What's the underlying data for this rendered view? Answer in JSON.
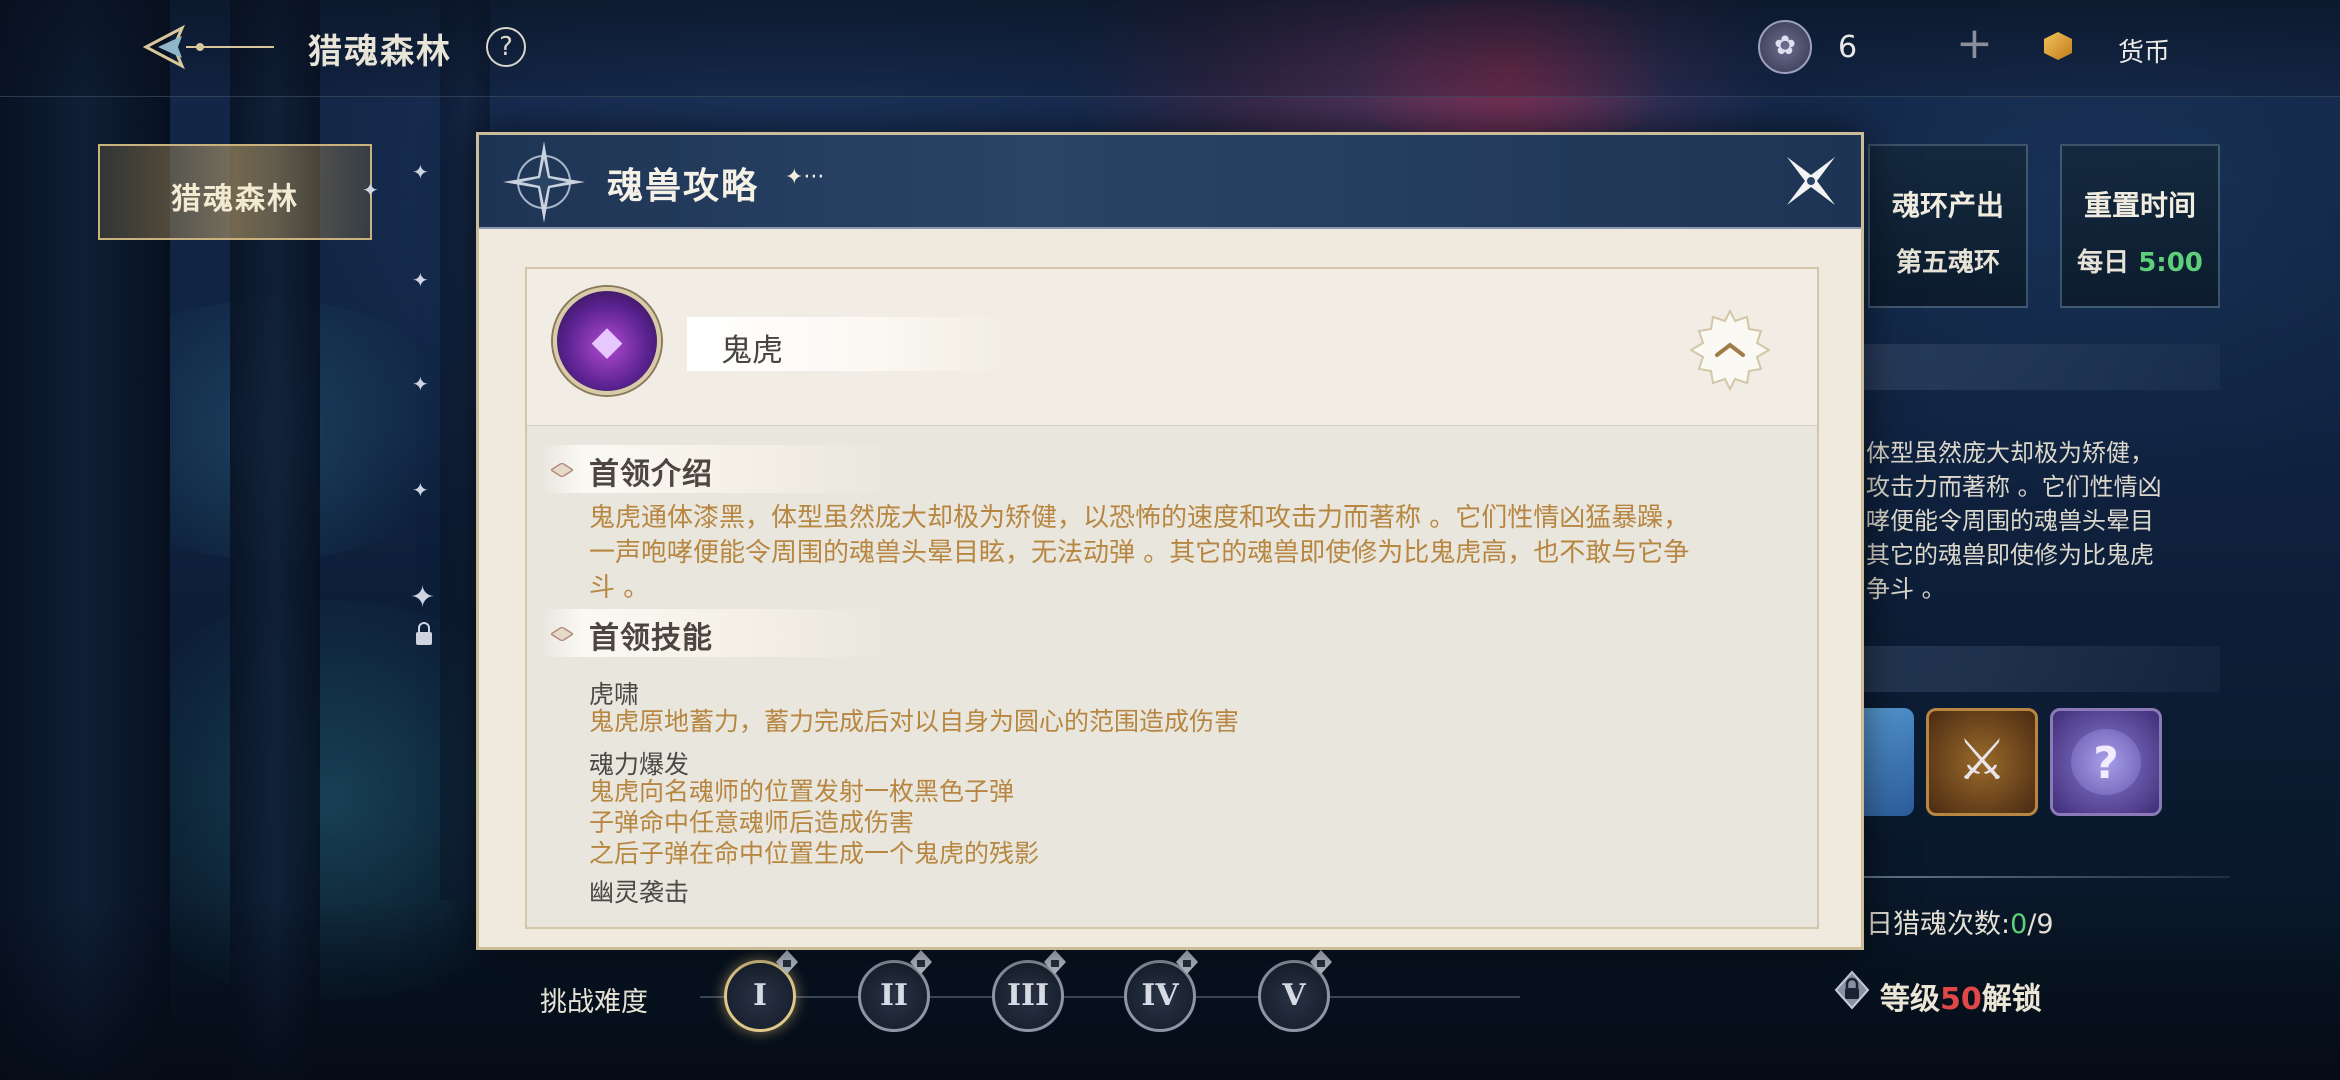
{
  "topbar": {
    "title": "猎魂森林",
    "help_glyph": "?",
    "emblem_count": "6",
    "plus_glyph": "+",
    "currency_label": "货币"
  },
  "sidebar": {
    "active_tab": "猎魂森林"
  },
  "right_panel": {
    "ring_title": "魂环产出",
    "ring_value": "第五魂环",
    "reset_title": "重置时间",
    "reset_prefix": "每日",
    "reset_time": "5:00",
    "desc_lines": [
      "体型虽然庞大却极为矫健，",
      "攻击力而著称 。它们性情凶",
      "哮便能令周围的魂兽头晕目",
      "其它的魂兽即使修为比鬼虎",
      "争斗 。"
    ],
    "hunt_prefix": "日猎魂次数:",
    "hunt_current": "0",
    "hunt_total": "/9",
    "unlock_prefix": "等级",
    "unlock_level": "50",
    "unlock_suffix": "解锁"
  },
  "difficulty": {
    "label": "挑战难度",
    "levels": [
      "I",
      "II",
      "III",
      "IV",
      "V"
    ],
    "selected": "I"
  },
  "modal": {
    "title": "魂兽攻略",
    "title_deco": "✦···",
    "boss_name": "鬼虎",
    "intro_title": "首领介绍",
    "intro_lines": [
      "鬼虎通体漆黑，体型虽然庞大却极为矫健，以恐怖的速度和攻击力而著称 。它们性情凶猛暴躁，",
      "一声咆哮便能令周围的魂兽头晕目眩，无法动弹 。其它的魂兽即使修为比鬼虎高，也不敢与它争",
      "斗 。"
    ],
    "skills_title": "首领技能",
    "skills": [
      {
        "name": "虎啸",
        "desc": [
          "鬼虎原地蓄力，蓄力完成后对以自身为圆心的范围造成伤害"
        ]
      },
      {
        "name": "魂力爆发",
        "desc": [
          "鬼虎向名魂师的位置发射一枚黑色子弹",
          "子弹命中任意魂师后造成伤害",
          "之后子弹在命中位置生成一个鬼虎的残影"
        ]
      },
      {
        "name": "幽灵袭击",
        "desc": []
      }
    ]
  },
  "colors": {
    "accent_gold": "#b78742",
    "highlight_green": "#5ed07a",
    "warning_red": "#e04848",
    "header_navy": "#1e3454",
    "parchment": "#efeadd"
  }
}
